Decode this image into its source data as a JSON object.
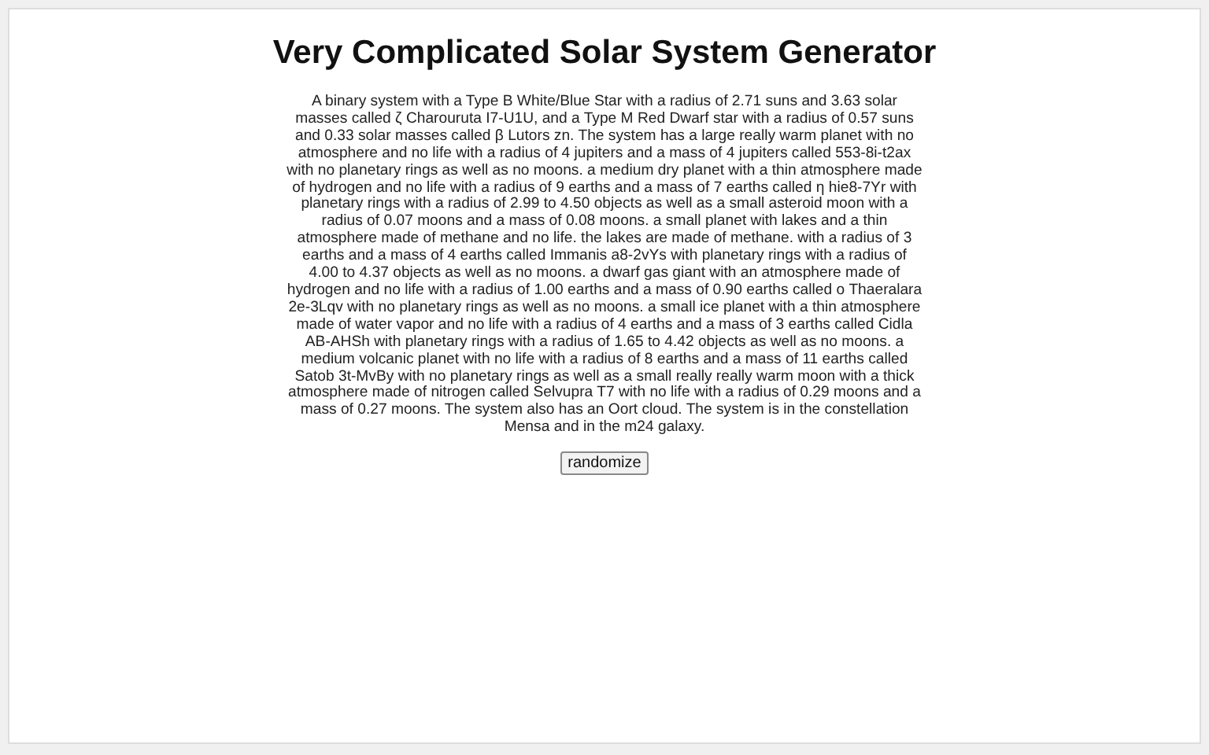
{
  "title": "Very Complicated Solar System Generator",
  "description": "A binary system with a Type B White/Blue Star with a radius of 2.71 suns and 3.63 solar masses called ζ Charouruta I7-U1U, and a Type M Red Dwarf star with a radius of 0.57 suns and 0.33 solar masses called β Lutors zn. The system has a large really warm planet with no atmosphere and no life with a radius of 4 jupiters and a mass of 4 jupiters called 553-8i-t2ax with no planetary rings as well as no moons. a medium dry planet with a thin atmosphere made of hydrogen and no life with a radius of 9 earths and a mass of 7 earths called η hie8-7Yr with planetary rings with a radius of 2.99 to 4.50 objects as well as a small asteroid moon with a radius of 0.07 moons and a mass of 0.08 moons. a small planet with lakes and a thin atmosphere made of methane and no life. the lakes are made of methane. with a radius of 3 earths and a mass of 4 earths called Immanis a8-2vYs with planetary rings with a radius of 4.00 to 4.37 objects as well as no moons. a dwarf gas giant with an atmosphere made of hydrogen and no life with a radius of 1.00 earths and a mass of 0.90 earths called ο Thaeralara 2e-3Lqv with no planetary rings as well as no moons. a small ice planet with a thin atmosphere made of water vapor and no life with a radius of 4 earths and a mass of 3 earths called Cidla AB-AHSh with planetary rings with a radius of 1.65 to 4.42 objects as well as no moons. a medium volcanic planet with no life with a radius of 8 earths and a mass of 11 earths called Satob 3t-MvBy with no planetary rings as well as a small really really warm moon with a thick atmosphere made of nitrogen called Selvupra T7 with no life with a radius of 0.29 moons and a mass of 0.27 moons. The system also has an Oort cloud. The system is in the constellation Mensa and in the m24 galaxy.",
  "button": "randomize"
}
